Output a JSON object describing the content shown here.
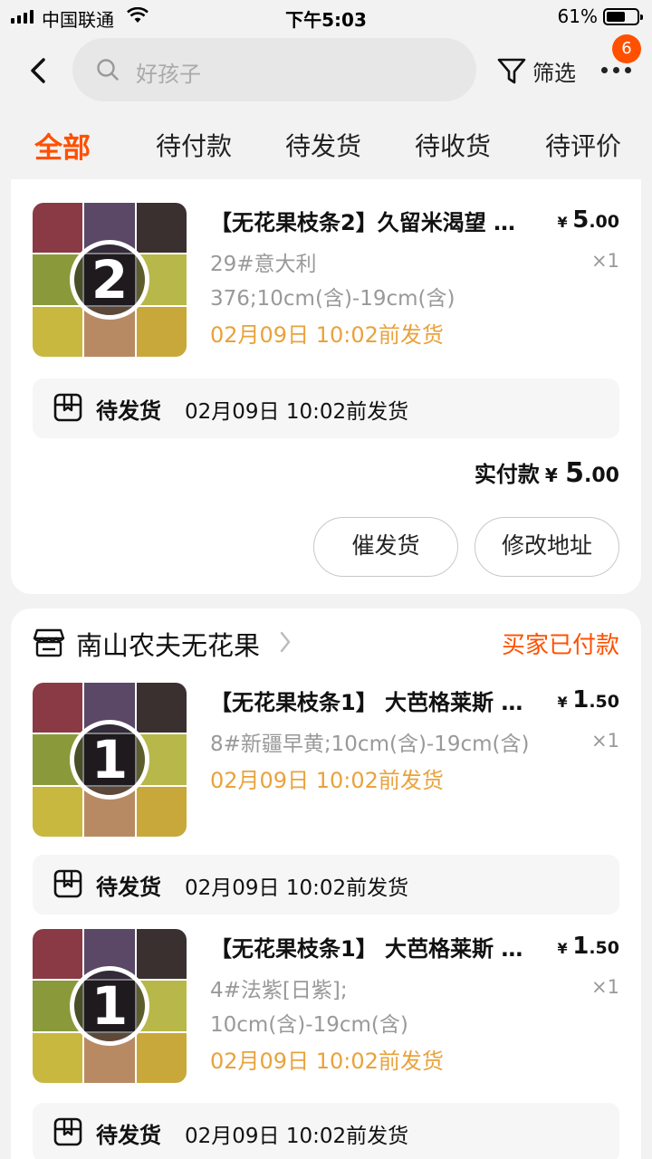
{
  "status_bar": {
    "carrier": "中国联通",
    "time": "下午5:03",
    "battery_percent": "61%",
    "battery_level": 0.61,
    "icons": [
      "signal-icon",
      "wifi-icon",
      "battery-icon"
    ]
  },
  "nav": {
    "search_placeholder": "好孩子",
    "filter_label": "筛选",
    "more_badge": "6",
    "icons": [
      "back-arrow-icon",
      "search-icon",
      "filter-icon",
      "more-icon"
    ]
  },
  "tabs": [
    {
      "label": "全部",
      "active": true
    },
    {
      "label": "待付款",
      "active": false
    },
    {
      "label": "待发货",
      "active": false
    },
    {
      "label": "待收货",
      "active": false
    },
    {
      "label": "待评价",
      "active": false
    }
  ],
  "colors": {
    "accent": "#ff5000",
    "ship_time": "#e9a23b",
    "muted": "#999999"
  },
  "orders": [
    {
      "items": [
        {
          "thumb_number": "2",
          "title": "【无花果枝条2】久留米渴望 …",
          "price": {
            "currency": "¥",
            "int": "5",
            "cents": ".00"
          },
          "sku_lines": [
            "29#意大利",
            "376;10cm(含)-19cm(含)"
          ],
          "qty": "×1",
          "ship_by": "02月09日 10:02前发货"
        }
      ],
      "ship_rows": [
        {
          "status": "待发货",
          "time": "02月09日 10:02前发货"
        }
      ],
      "paid": {
        "label": "实付款",
        "currency": "¥",
        "int": "5",
        "cents": ".00"
      },
      "buttons": [
        "催发货",
        "修改地址"
      ]
    },
    {
      "shop_name": "南山农夫无花果",
      "status": "买家已付款",
      "items": [
        {
          "thumb_number": "1",
          "title": "【无花果枝条1】 大芭格莱斯 …",
          "price": {
            "currency": "¥",
            "int": "1",
            "cents": ".50"
          },
          "sku_lines": [
            "8#新疆早黄;10cm(含)-19cm(含)"
          ],
          "qty": "×1",
          "ship_by": "02月09日 10:02前发货"
        },
        {
          "thumb_number": "1",
          "title": "【无花果枝条1】 大芭格莱斯 …",
          "price": {
            "currency": "¥",
            "int": "1",
            "cents": ".50"
          },
          "sku_lines": [
            "4#法紫[日紫];",
            "10cm(含)-19cm(含)"
          ],
          "qty": "×1",
          "ship_by": "02月09日 10:02前发货"
        }
      ],
      "ship_rows": [
        {
          "status": "待发货",
          "time": "02月09日 10:02前发货"
        },
        {
          "status": "待发货",
          "time": "02月09日 10:02前发货"
        }
      ]
    }
  ]
}
